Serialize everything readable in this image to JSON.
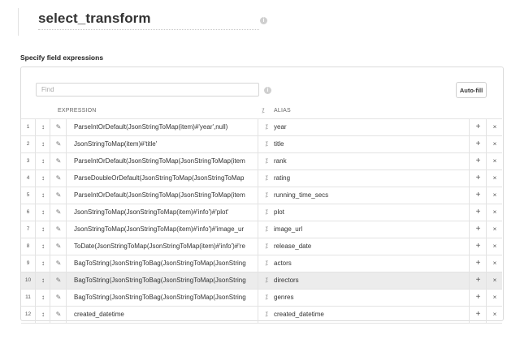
{
  "header": {
    "title": "select_transform",
    "info_icon": "i"
  },
  "section": {
    "label": "Specify field expressions"
  },
  "search": {
    "placeholder": "Find",
    "info_icon": "i"
  },
  "toolbar": {
    "autofill_label": "Auto-fill"
  },
  "columns": {
    "expression": "EXPRESSION",
    "alias": "ALIAS",
    "wand_icon": "⁒"
  },
  "row_icons": {
    "drag": "↕",
    "edit": "✎",
    "wand": "⁒",
    "add": "+",
    "delete": "×"
  },
  "rows": [
    {
      "num": "1",
      "expression": "ParseIntOrDefault(JsonStringToMap(item)#'year',null)",
      "alias": "year"
    },
    {
      "num": "2",
      "expression": "JsonStringToMap(item)#'title'",
      "alias": "title"
    },
    {
      "num": "3",
      "expression": "ParseIntOrDefault(JsonStringToMap(JsonStringToMap(item",
      "alias": "rank"
    },
    {
      "num": "4",
      "expression": "ParseDoubleOrDefault(JsonStringToMap(JsonStringToMap",
      "alias": "rating"
    },
    {
      "num": "5",
      "expression": "ParseIntOrDefault(JsonStringToMap(JsonStringToMap(item",
      "alias": "running_time_secs"
    },
    {
      "num": "6",
      "expression": "JsonStringToMap(JsonStringToMap(item)#'info')#'plot'",
      "alias": "plot"
    },
    {
      "num": "7",
      "expression": "JsonStringToMap(JsonStringToMap(item)#'info')#'image_ur",
      "alias": "image_url"
    },
    {
      "num": "8",
      "expression": "ToDate(JsonStringToMap(JsonStringToMap(item)#'info')#'re",
      "alias": "release_date"
    },
    {
      "num": "9",
      "expression": "BagToString(JsonStringToBag(JsonStringToMap(JsonString",
      "alias": "actors"
    },
    {
      "num": "10",
      "expression": "BagToString(JsonStringToBag(JsonStringToMap(JsonString",
      "alias": "directors"
    },
    {
      "num": "11",
      "expression": "BagToString(JsonStringToBag(JsonStringToMap(JsonString",
      "alias": "genres"
    },
    {
      "num": "12",
      "expression": "created_datetime",
      "alias": "created_datetime"
    }
  ],
  "highlighted_row": 10
}
